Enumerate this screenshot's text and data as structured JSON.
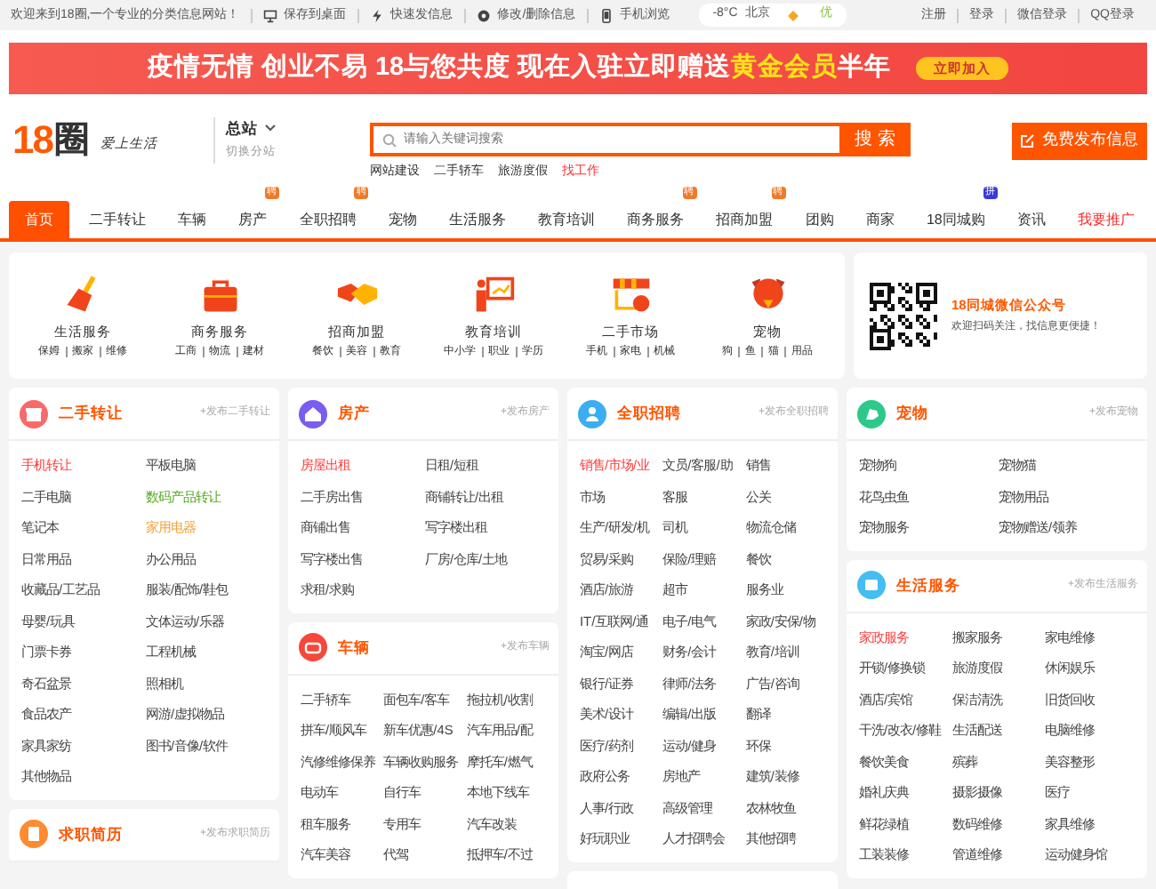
{
  "top_bar": {
    "welcome": "欢迎来到18圈,一个专业的分类信息网站！",
    "links": [
      {
        "kind": "monitor",
        "label": "保存到桌面"
      },
      {
        "kind": "bolt",
        "label": "快速发信息"
      },
      {
        "kind": "gear",
        "label": "修改/删除信息"
      },
      {
        "kind": "phone",
        "label": "手机浏览"
      }
    ],
    "weather": {
      "temperature": "-8°C",
      "city": "北京",
      "air": "优"
    },
    "account_links": [
      "注册",
      "登录",
      "微信登录",
      "QQ登录"
    ]
  },
  "banner": {
    "lead": "疫情无情 创业不易 18与您共度 现在入驻立即赠送",
    "highlight": "黄金会员",
    "tail": "半年",
    "button": "立即加入"
  },
  "header": {
    "logo": {
      "number": "18",
      "char": "圈",
      "slogan": "爱上生活"
    },
    "station": "总站",
    "switch": "切换分站",
    "search": {
      "placeholder": "请输入关键词搜索",
      "button": "搜 索"
    },
    "hot_links": [
      {
        "label": "网站建设",
        "hot": false
      },
      {
        "label": "二手轿车",
        "hot": false
      },
      {
        "label": "旅游度假",
        "hot": false
      },
      {
        "label": "找工作",
        "hot": true
      }
    ],
    "post_button": "免费发布信息"
  },
  "nav": [
    {
      "label": "首页",
      "selected": true,
      "highlighted": false
    },
    {
      "label": "二手转让",
      "selected": false,
      "highlighted": false
    },
    {
      "label": "车辆",
      "selected": false,
      "highlighted": false
    },
    {
      "label": "房产",
      "selected": false,
      "highlighted": false,
      "badge": {
        "text": "聘",
        "color": "#f07a2a"
      }
    },
    {
      "label": "全职招聘",
      "selected": false,
      "highlighted": false,
      "badge": {
        "text": "聘",
        "color": "#f07a2a"
      }
    },
    {
      "label": "宠物",
      "selected": false,
      "highlighted": false
    },
    {
      "label": "生活服务",
      "selected": false,
      "highlighted": false
    },
    {
      "label": "教育培训",
      "selected": false,
      "highlighted": false
    },
    {
      "label": "商务服务",
      "selected": false,
      "highlighted": false,
      "badge": {
        "text": "聘",
        "color": "#f07a2a"
      }
    },
    {
      "label": "招商加盟",
      "selected": false,
      "highlighted": false,
      "badge": {
        "text": "聘",
        "color": "#f07a2a"
      }
    },
    {
      "label": "团购",
      "selected": false,
      "highlighted": false
    },
    {
      "label": "商家",
      "selected": false,
      "highlighted": false
    },
    {
      "label": "18同城购",
      "selected": false,
      "highlighted": false,
      "badge": {
        "text": "拼",
        "color": "#3a3ad8"
      }
    },
    {
      "label": "资讯",
      "selected": false,
      "highlighted": false
    },
    {
      "label": "我要推广",
      "selected": false,
      "highlighted": true
    }
  ],
  "categories": [
    {
      "kind": "broom",
      "name": "生活服务",
      "subs": [
        "保姆",
        "搬家",
        "维修"
      ]
    },
    {
      "kind": "briefcase",
      "name": "商务服务",
      "subs": [
        "工商",
        "物流",
        "建材"
      ]
    },
    {
      "kind": "handshake",
      "name": "招商加盟",
      "subs": [
        "餐饮",
        "美容",
        "教育"
      ]
    },
    {
      "kind": "teaching",
      "name": "教育培训",
      "subs": [
        "中小学",
        "职业",
        "学历"
      ]
    },
    {
      "kind": "shop",
      "name": "二手市场",
      "subs": [
        "手机",
        "家电",
        "机械"
      ]
    },
    {
      "kind": "dog",
      "name": "宠物",
      "subs": [
        "狗",
        "鱼",
        "猫",
        "用品"
      ]
    }
  ],
  "wechat": {
    "title": "18同城微信公众号",
    "subtitle": "欢迎扫码关注，找信息更便捷！"
  },
  "columns": [
    [
      {
        "kind": "gift",
        "title": "二手转让",
        "color": "#f86a6a",
        "post_link": "+发布二手转让",
        "three_columns": false,
        "items": [
          {
            "label": "手机转让",
            "color": "#ff3b3b"
          },
          "平板电脑",
          "二手电脑",
          {
            "label": "数码产品转让",
            "color": "#55aa22"
          },
          "笔记本",
          {
            "label": "家用电器",
            "color": "#f5a23a"
          },
          "日常用品",
          "办公用品",
          "收藏品/工艺品",
          "服装/配饰/鞋包",
          "母婴/玩具",
          "文体运动/乐器",
          "门票卡券",
          "工程机械",
          "奇石盆景",
          "照相机",
          "食品农产",
          "网游/虚拟物品",
          "家具家纺",
          "图书/音像/软件",
          "其他物品"
        ]
      },
      {
        "kind": "document",
        "title": "求职简历",
        "color": "#ff8a30",
        "post_link": "+发布求职简历"
      }
    ],
    [
      {
        "kind": "house",
        "title": "房产",
        "color": "#7a5cf0",
        "post_link": "+发布房产",
        "three_columns": false,
        "items": [
          {
            "label": "房屋出租",
            "color": "#ff3b3b"
          },
          "日租/短租",
          "二手房出售",
          "商铺转让/出租",
          "商铺出售",
          "写字楼出租",
          "写字楼出售",
          "厂房/仓库/土地",
          "求租/求购"
        ]
      },
      {
        "kind": "car",
        "title": "车辆",
        "color": "#f5483a",
        "post_link": "+发布车辆",
        "three_columns": true,
        "items": [
          "二手轿车",
          "面包车/客车",
          "拖拉机/收割",
          "拼车/顺风车",
          "新车优惠/4S",
          "汽车用品/配",
          "汽修维修保养",
          "车辆收购服务",
          "摩托车/燃气",
          "电动车",
          "自行车",
          "本地下线车",
          "租车服务",
          "专用车",
          "汽车改装",
          "汽车美容",
          "代驾",
          "抵押车/不过"
        ]
      }
    ],
    [
      {
        "kind": "person",
        "title": "全职招聘",
        "color": "#3aaef0",
        "post_link": "+发布全职招聘",
        "three_columns": true,
        "items": [
          {
            "label": "销售/市场/业",
            "color": "#ff3b3b"
          },
          "文员/客服/助",
          "销售",
          "市场",
          "客服",
          "公关",
          "生产/研发/机",
          "司机",
          "物流仓储",
          "贸易/采购",
          "保险/理赔",
          "餐饮",
          "酒店/旅游",
          "超市",
          "服务业",
          "IT/互联网/通",
          "电子/电气",
          "家政/安保/物",
          "淘宝/网店",
          "财务/会计",
          "教育/培训",
          "银行/证券",
          "律师/法务",
          "广告/咨询",
          "美术/设计",
          "编辑/出版",
          "翻译",
          "医疗/药剂",
          "运动/健身",
          "环保",
          "政府公务",
          "房地产",
          "建筑/装修",
          "人事/行政",
          "高级管理",
          "农林牧鱼",
          "好玩职业",
          "人才招聘会",
          "其他招聘"
        ]
      },
      {
        "kind": "blank"
      }
    ],
    [
      {
        "kind": "dog",
        "title": "宠物",
        "color": "#2ec98a",
        "post_link": "+发布宠物",
        "three_columns": false,
        "items": [
          "宠物狗",
          "宠物猫",
          "花鸟虫鱼",
          "宠物用品",
          "宠物服务",
          "宠物赠送/领养"
        ]
      },
      {
        "kind": "tray",
        "title": "生活服务",
        "color": "#45bdf2",
        "post_link": "+发布生活服务",
        "three_columns": true,
        "items": [
          {
            "label": "家政服务",
            "color": "#ff3b3b"
          },
          "搬家服务",
          "家电维修",
          "开锁/修换锁",
          "旅游度假",
          "休闲娱乐",
          "酒店/宾馆",
          "保洁清洗",
          "旧货回收",
          "干洗/改衣/修鞋",
          "生活配送",
          "电脑维修",
          "餐饮美食",
          "殡葬",
          "美容整形",
          "婚礼庆典",
          "摄影摄像",
          "医疗",
          "鲜花绿植",
          "数码维修",
          "家具维修",
          "工装装修",
          "管道维修",
          "运动健身馆"
        ]
      }
    ]
  ]
}
